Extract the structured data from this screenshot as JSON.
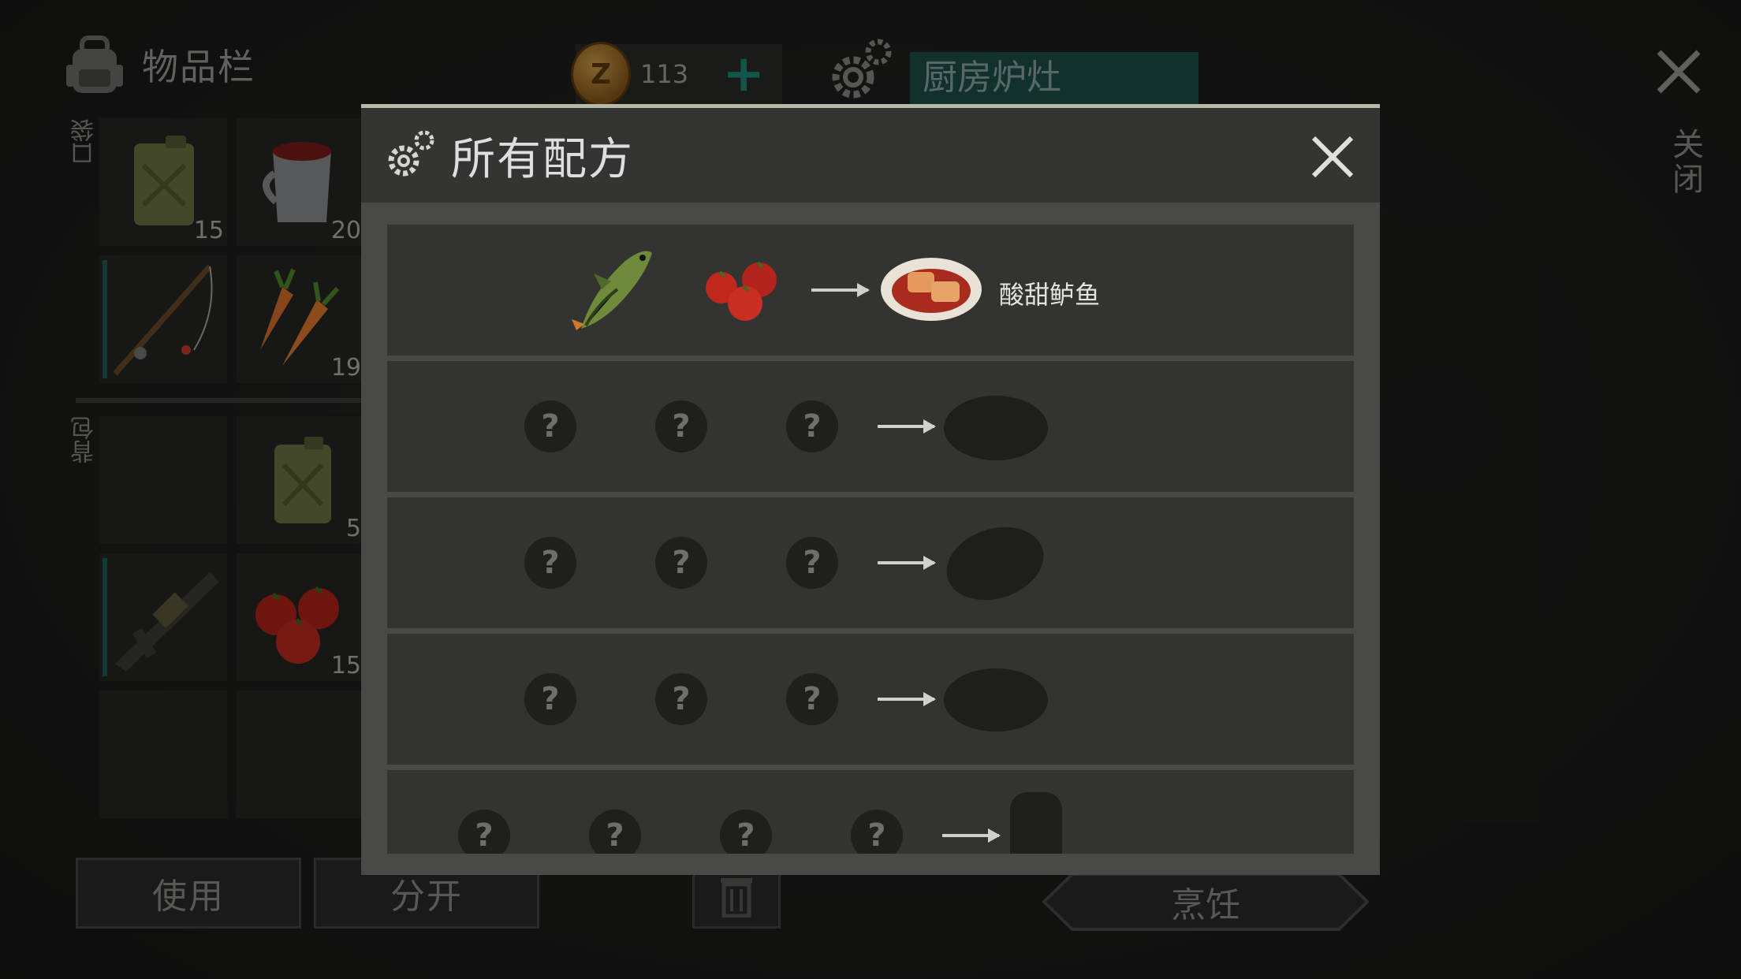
{
  "inventory": {
    "title": "物品栏",
    "pocket_label": "口袋",
    "backpack_label": "背包",
    "slots": [
      {
        "icon": "fuel-canister-icon",
        "count": "15"
      },
      {
        "icon": "cup-of-juice-icon",
        "count": "20"
      },
      {
        "icon": "fishing-rod-icon",
        "count": ""
      },
      {
        "icon": "carrot-icon",
        "count": "19"
      },
      {
        "icon": "empty-slot",
        "count": ""
      },
      {
        "icon": "fuel-canister-icon",
        "count": "5"
      },
      {
        "icon": "grenade-launcher-icon",
        "count": ""
      },
      {
        "icon": "tomato-icon",
        "count": "15"
      }
    ]
  },
  "currency": {
    "count": "113",
    "coin_symbol": "Z",
    "plus": "+"
  },
  "station": {
    "name": "厨房炉灶"
  },
  "close": {
    "label": "关闭"
  },
  "buttons": {
    "use": "使用",
    "split": "分开",
    "cook": "烹饪"
  },
  "recipes_modal": {
    "title": "所有配方",
    "unknown_symbol": "?",
    "recipes": [
      {
        "known": true,
        "ingredients": [
          "perch-fish-icon",
          "tomato-icon"
        ],
        "result_icon": "sweet-sour-perch-icon",
        "result_name": "酸甜鲈鱼"
      },
      {
        "known": false,
        "ingredient_count": 3
      },
      {
        "known": false,
        "ingredient_count": 3
      },
      {
        "known": false,
        "ingredient_count": 3
      },
      {
        "known": false,
        "ingredient_count": 4
      }
    ]
  },
  "colors": {
    "accent_teal": "#1d4f4a",
    "plus_teal": "#1f8a78",
    "modal_bg": "#494947",
    "row_bg": "#333331"
  }
}
